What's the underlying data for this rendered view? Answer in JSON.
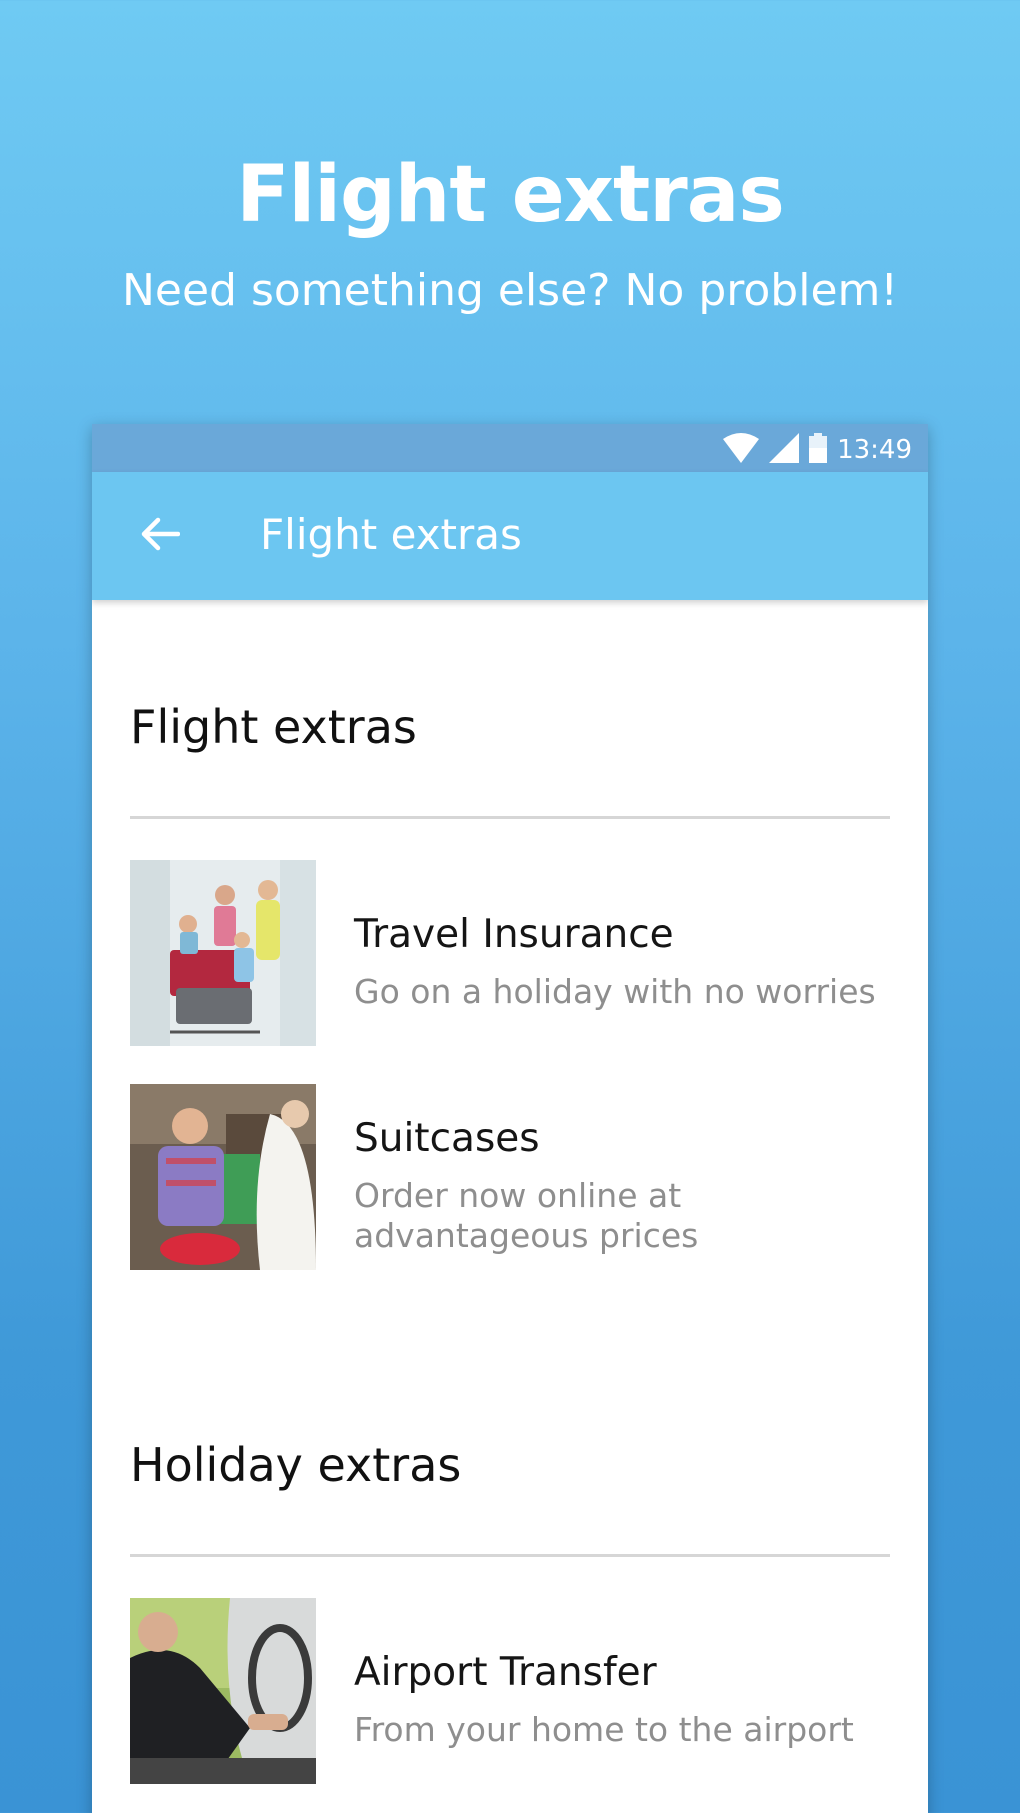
{
  "promo": {
    "title": "Flight extras",
    "subtitle": "Need something else? No problem!"
  },
  "statusbar": {
    "time": "13:49",
    "icons": [
      "wifi-icon",
      "signal-icon",
      "battery-icon"
    ]
  },
  "appbar": {
    "back_icon": "arrow-left-icon",
    "title": "Flight extras"
  },
  "sections": [
    {
      "title": "Flight extras",
      "items": [
        {
          "title": "Travel Insurance",
          "subtitle": "Go on a holiday with no worries",
          "image": "family-luggage-photo"
        },
        {
          "title": "Suitcases",
          "subtitle": "Order now online at advantageous prices",
          "image": "suitcase-shop-photo"
        }
      ]
    },
    {
      "title": "Holiday extras",
      "items": [
        {
          "title": "Airport Transfer",
          "subtitle": "From your home to the airport",
          "image": "driver-photo"
        }
      ]
    }
  ],
  "colors": {
    "background_top": "#6fcaf3",
    "background_bottom": "#3a93d5",
    "statusbar": "#6aa8d9",
    "appbar": "#6cc6f1",
    "subtitle_text": "#8e8e8e",
    "divider": "#d6d6d6"
  }
}
